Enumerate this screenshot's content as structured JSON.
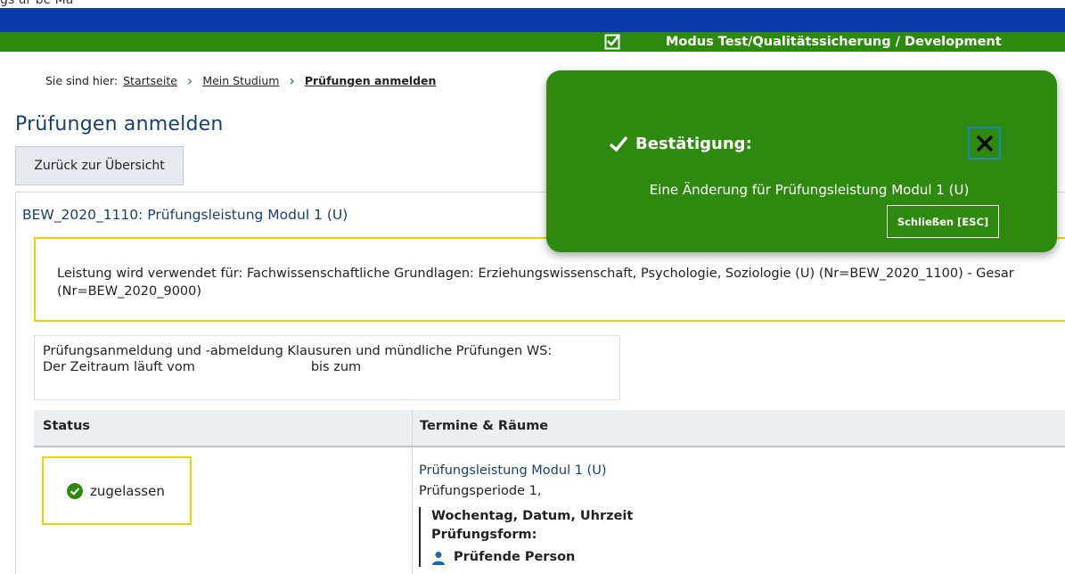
{
  "top_strip_text": "gs ur be Ma",
  "mode_banner": {
    "text": "Modus Test/Qualitätssicherung / Development"
  },
  "breadcrumb": {
    "prefix": "Sie sind hier:",
    "items": [
      "Startseite",
      "Mein Studium"
    ],
    "current": "Prüfungen anmelden"
  },
  "page_title": "Prüfungen anmelden",
  "back_button": "Zurück zur Übersicht",
  "exam": {
    "title": "BEW_2020_1110: Prüfungsleistung Modul 1 (U)",
    "usage_line1": "Leistung wird verwendet für: Fachwissenschaftliche Grundlagen: Erziehungswissenschaft, Psychologie, Soziologie (U) (Nr=BEW_2020_1100) - Gesar",
    "usage_line2": "(Nr=BEW_2020_9000)",
    "period_line1": "Prüfungsanmeldung und -abmeldung Klausuren und mündliche Prüfungen WS:",
    "period_prefix": "Der Zeitraum läuft vom",
    "period_middle": "bis zum"
  },
  "table": {
    "headers": {
      "status": "Status",
      "termine": "Termine & Räume"
    },
    "status": "zugelassen",
    "termine": {
      "link": "Prüfungsleistung Modul 1 (U)",
      "period": "Prüfungsperiode 1,",
      "date_label": "Wochentag, Datum, Uhrzeit",
      "form_label": "Prüfungsform:",
      "person_label": "Prüfende Person"
    }
  },
  "toast": {
    "heading": "Bestätigung:",
    "message": "Eine Änderung für Prüfungsleistung Modul 1 (U)",
    "close_button": "Schließen [ESC]"
  },
  "colors": {
    "mode_bar": "#2e8a0f",
    "top_bar": "#0a3aa8",
    "highlight": "#f0d400",
    "title": "#17416b"
  }
}
